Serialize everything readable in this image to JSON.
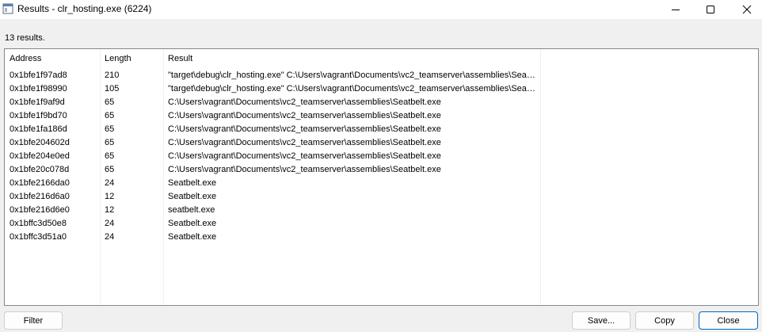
{
  "window": {
    "title": "Results - clr_hosting.exe (6224)"
  },
  "summary": {
    "count_label": "13 results."
  },
  "table": {
    "headers": [
      "Address",
      "Length",
      "Result"
    ],
    "rows": [
      {
        "address": "0x1bfe1f97ad8",
        "length": "210",
        "result": "\"target\\debug\\clr_hosting.exe\" C:\\Users\\vagrant\\Documents\\vc2_teamserver\\assemblies\\Seatbelt.exe"
      },
      {
        "address": "0x1bfe1f98990",
        "length": "105",
        "result": "\"target\\debug\\clr_hosting.exe\" C:\\Users\\vagrant\\Documents\\vc2_teamserver\\assemblies\\Seatbelt.exe"
      },
      {
        "address": "0x1bfe1f9af9d",
        "length": "65",
        "result": "C:\\Users\\vagrant\\Documents\\vc2_teamserver\\assemblies\\Seatbelt.exe"
      },
      {
        "address": "0x1bfe1f9bd70",
        "length": "65",
        "result": "C:\\Users\\vagrant\\Documents\\vc2_teamserver\\assemblies\\Seatbelt.exe"
      },
      {
        "address": "0x1bfe1fa186d",
        "length": "65",
        "result": "C:\\Users\\vagrant\\Documents\\vc2_teamserver\\assemblies\\Seatbelt.exe"
      },
      {
        "address": "0x1bfe204602d",
        "length": "65",
        "result": "C:\\Users\\vagrant\\Documents\\vc2_teamserver\\assemblies\\Seatbelt.exe"
      },
      {
        "address": "0x1bfe204e0ed",
        "length": "65",
        "result": "C:\\Users\\vagrant\\Documents\\vc2_teamserver\\assemblies\\Seatbelt.exe"
      },
      {
        "address": "0x1bfe20c078d",
        "length": "65",
        "result": "C:\\Users\\vagrant\\Documents\\vc2_teamserver\\assemblies\\Seatbelt.exe"
      },
      {
        "address": "0x1bfe2166da0",
        "length": "24",
        "result": "Seatbelt.exe"
      },
      {
        "address": "0x1bfe216d6a0",
        "length": "12",
        "result": "Seatbelt.exe"
      },
      {
        "address": "0x1bfe216d6e0",
        "length": "12",
        "result": "seatbelt.exe"
      },
      {
        "address": "0x1bffc3d50e8",
        "length": "24",
        "result": "Seatbelt.exe"
      },
      {
        "address": "0x1bffc3d51a0",
        "length": "24",
        "result": "Seatbelt.exe"
      }
    ]
  },
  "buttons": {
    "filter": "Filter",
    "save": "Save...",
    "copy": "Copy",
    "close": "Close"
  },
  "icons": {
    "app": "window-app-icon",
    "minimize": "minimize-icon",
    "maximize": "maximize-icon",
    "close": "close-icon"
  },
  "colors": {
    "default_button_border": "#0067c0",
    "list_border": "#828790"
  }
}
